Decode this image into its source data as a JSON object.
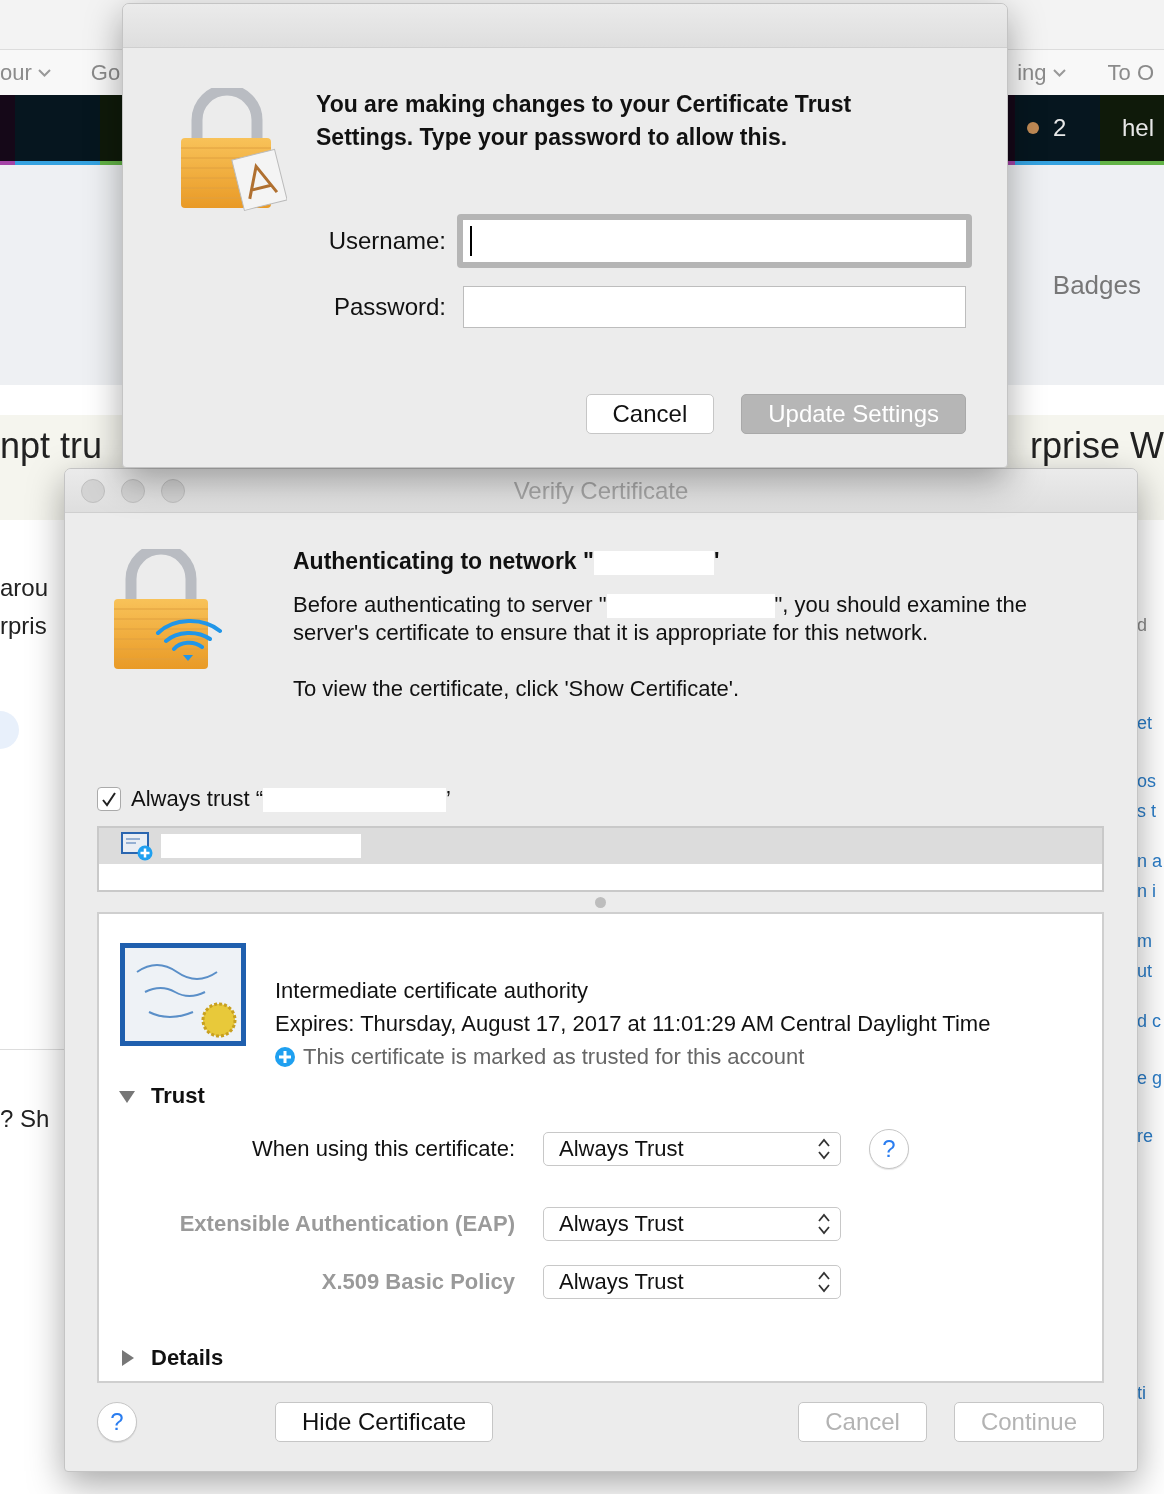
{
  "background_page": {
    "nav_left": [
      {
        "label": "our",
        "caret": true
      },
      {
        "label": "Go",
        "caret": false
      }
    ],
    "nav_right": [
      {
        "label": "ing",
        "caret": true
      },
      {
        "label": "To O",
        "caret": false
      }
    ],
    "toolbar": {
      "count": "2",
      "link": "hel"
    },
    "hero": {
      "label": "Badges"
    },
    "banner": {
      "left": "npt tru",
      "right": "rprise W"
    },
    "left_column": [
      "arou",
      "rpris",
      "? Sh"
    ],
    "right_column": [
      {
        "text": "d",
        "kind": "text"
      },
      {
        "text": "et",
        "kind": "link"
      },
      {
        "text": "os",
        "kind": "link"
      },
      {
        "text": "s t",
        "kind": "link"
      },
      {
        "text": "n a",
        "kind": "link"
      },
      {
        "text": "n i",
        "kind": "link"
      },
      {
        "text": "m",
        "kind": "link"
      },
      {
        "text": "ut",
        "kind": "link"
      },
      {
        "text": "d c",
        "kind": "link"
      },
      {
        "text": "e g",
        "kind": "link"
      },
      {
        "text": "re",
        "kind": "link"
      },
      {
        "text": "ti",
        "kind": "link"
      }
    ]
  },
  "auth_dialog": {
    "message": "You are making changes to your Certificate Trust Settings. Type your password to allow this.",
    "fields": [
      {
        "label": "Username:",
        "focused": true
      },
      {
        "label": "Password:",
        "focused": false
      }
    ],
    "buttons": [
      {
        "label": "Cancel",
        "kind": "normal"
      },
      {
        "label": "Update Settings",
        "kind": "default"
      }
    ]
  },
  "verify_dialog": {
    "title": "Verify Certificate",
    "heading": {
      "before": "Authenticating to network \"",
      "after": "'"
    },
    "message": {
      "before": "Before authenticating to server \"",
      "after": "\", you should examine the server's certificate to ensure that it is appropriate for this network."
    },
    "instruction": "To view the certificate, click 'Show Certificate'.",
    "always_trust": {
      "before": "Always trust “",
      "after": "’",
      "checked": true
    },
    "certificate_list": [
      {
        "selected": true
      }
    ],
    "certificate": {
      "type": "Intermediate certificate authority",
      "expires": "Expires: Thursday, August 17, 2017 at 11:01:29 AM Central Daylight Time",
      "status": "This certificate is marked as trusted for this account"
    },
    "trust": {
      "label": "Trust",
      "expanded": true,
      "rows": [
        {
          "label": "When using this certificate:",
          "value": "Always Trust",
          "kind": "main",
          "help_button": "?"
        },
        {
          "label": "Extensible Authentication (EAP)",
          "value": "Always Trust",
          "kind": "policy"
        },
        {
          "label": "X.509 Basic Policy",
          "value": "Always Trust",
          "kind": "policy"
        }
      ]
    },
    "details": {
      "label": "Details",
      "expanded": false
    },
    "help_button": "?",
    "buttons": [
      {
        "label": "Hide Certificate",
        "disabled": false
      },
      {
        "label": "Cancel",
        "disabled": true
      },
      {
        "label": "Continue",
        "disabled": true
      }
    ]
  }
}
